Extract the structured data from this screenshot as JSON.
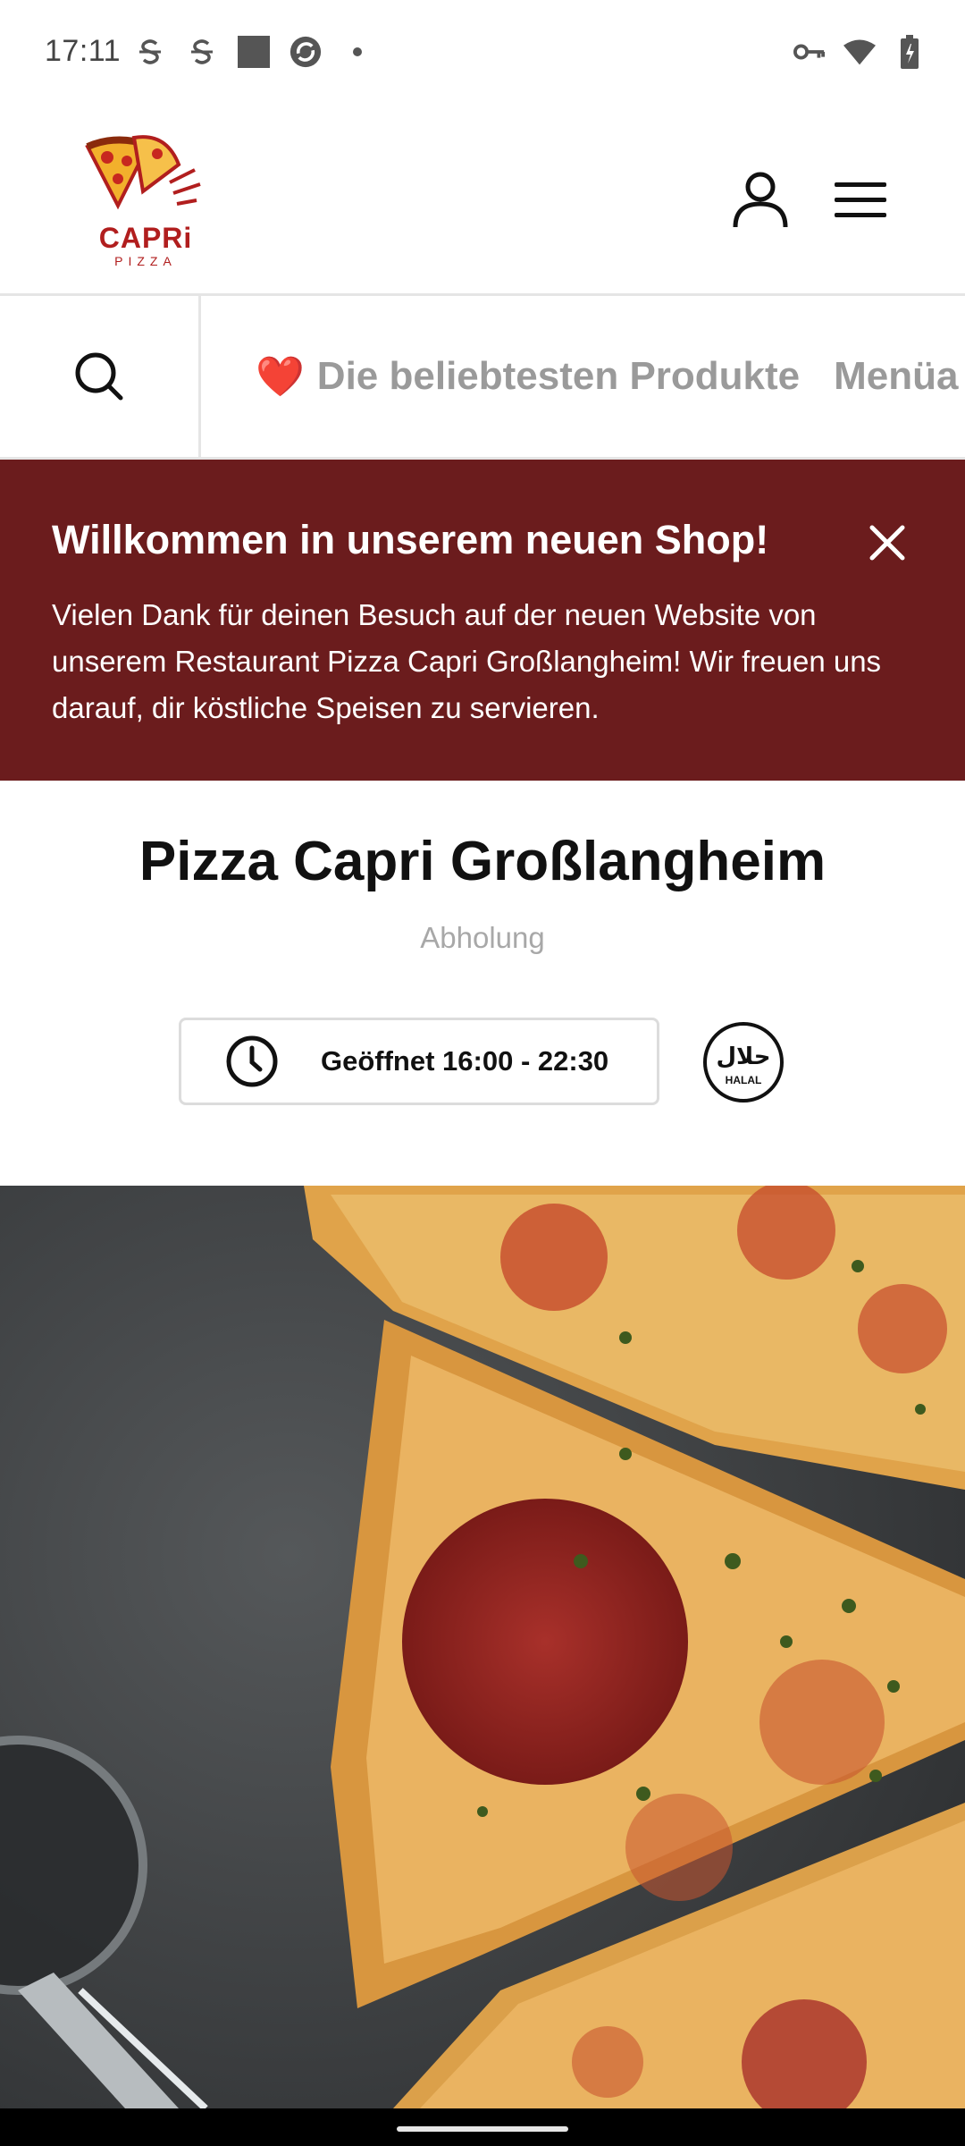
{
  "status_bar": {
    "time": "17:11",
    "left_icons": [
      "s-icon",
      "s-icon",
      "square-icon",
      "sync-icon",
      "dot-icon"
    ],
    "right_icons": [
      "key-icon",
      "wifi-icon",
      "battery-icon"
    ]
  },
  "header": {
    "logo_text": "CAPRi",
    "logo_sub": "PIZZA",
    "user_icon": "user-icon",
    "menu_icon": "hamburger-icon"
  },
  "categories": {
    "search_icon": "search-icon",
    "items": [
      {
        "emoji": "❤️",
        "label": "Die beliebtesten Produkte"
      },
      {
        "emoji": "",
        "label": "Menüa"
      }
    ]
  },
  "banner": {
    "title": "Willkommen in unserem neuen Shop!",
    "text": "Vielen Dank für deinen Besuch auf der neuen Website von unserem Restaurant Pizza Capri Großlangheim! Wir freuen uns darauf, dir köstliche Speisen zu servieren.",
    "close_icon": "close-icon",
    "bg_color": "#6b1c1d"
  },
  "restaurant": {
    "name": "Pizza Capri Großlangheim",
    "mode": "Abholung",
    "hours": "Geöffnet 16:00 - 22:30",
    "clock_icon": "clock-icon",
    "halal_label": "HALAL",
    "halal_arabic": "حلال"
  },
  "hero": {
    "image": "pizza-photo"
  }
}
